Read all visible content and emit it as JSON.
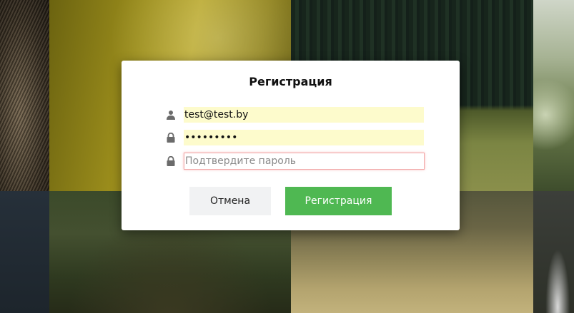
{
  "modal": {
    "title": "Регистрация"
  },
  "form": {
    "email": {
      "value": "test@test.by",
      "icon": "user-icon"
    },
    "password": {
      "value": "•••••••••",
      "icon": "lock-icon"
    },
    "confirm": {
      "value": "",
      "placeholder": "Подтвердите пароль",
      "icon": "lock-icon"
    }
  },
  "buttons": {
    "cancel_label": "Отмена",
    "register_label": "Регистрация"
  },
  "colors": {
    "autofill": "#fdfbcc",
    "error_border": "#f2a9a9",
    "primary": "#4fb852",
    "secondary": "#f1f2f3"
  }
}
